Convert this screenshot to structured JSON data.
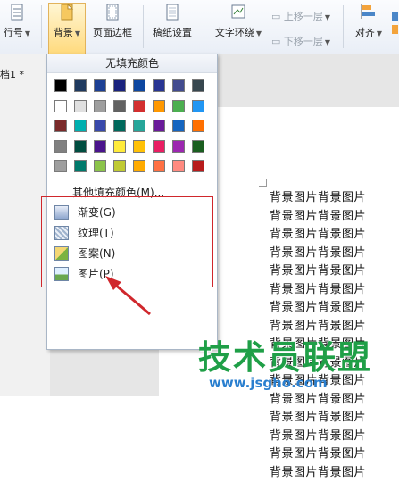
{
  "ribbon": {
    "row_label": "行号",
    "background_label": "背景",
    "page_border_label": "页面边框",
    "paper_settings_label": "稿纸设置",
    "text_wrap_label": "文字环绕",
    "move_up_label": "上移一层",
    "move_down_label": "下移一层",
    "align_label": "对齐"
  },
  "document": {
    "tab_label": "档1 *",
    "background_lines": [
      "背景图片背景图片",
      "背景图片背景图片",
      "背景图片背景图片",
      "背景图片背景图片",
      "背景图片背景图片",
      "背景图片背景图片",
      "背景图片背景图片",
      "背景图片背景图片",
      "背景图片背景图片",
      "背景图片背景图片",
      "背景图片背景图片",
      "背景图片背景图片",
      "背景图片背景图片",
      "背景图片背景图片",
      "背景图片背景图片",
      "背景图片背景图片"
    ]
  },
  "dropdown": {
    "no_fill_label": "无填充颜色",
    "swatch_rows": [
      [
        "#000000",
        "#1f3a5f",
        "#1c3f94",
        "#1a237e",
        "#0d47a1",
        "#283593",
        "#424b8f",
        "#37474f"
      ],
      [
        "#ffffff",
        "#e0e0e0",
        "#9e9e9e",
        "#616161",
        "#d32f2f",
        "#ff9800",
        "#4caf50",
        "#2196f3"
      ],
      [
        "#7a2a2a",
        "#00b0b0",
        "#3949ab",
        "#00695c",
        "#26a69a",
        "#6a1b9a",
        "#1565c0",
        "#ff6f00"
      ],
      [
        "#808080",
        "#004d40",
        "#4a148c",
        "#ffeb3b",
        "#ffc107",
        "#e91e63",
        "#9c27b0",
        "#1b5e20"
      ],
      [
        "#9e9e9e",
        "#00796b",
        "#8bc34a",
        "#c0ca33",
        "#ffab00",
        "#ff7043",
        "#ff8a80",
        "#b71c1c"
      ]
    ],
    "more_colors_label": "其他填充颜色(M)...",
    "items": [
      {
        "label": "渐变(G)",
        "icon": "gradient-icon"
      },
      {
        "label": "纹理(T)",
        "icon": "texture-icon"
      },
      {
        "label": "图案(N)",
        "icon": "pattern-icon"
      },
      {
        "label": "图片(P)",
        "icon": "picture-icon"
      }
    ]
  },
  "watermark": {
    "text": "技术员联盟",
    "url": "www.jsgho.com"
  },
  "colors": {
    "highlight_box": "#d0272c",
    "arrow": "#d0272c"
  }
}
